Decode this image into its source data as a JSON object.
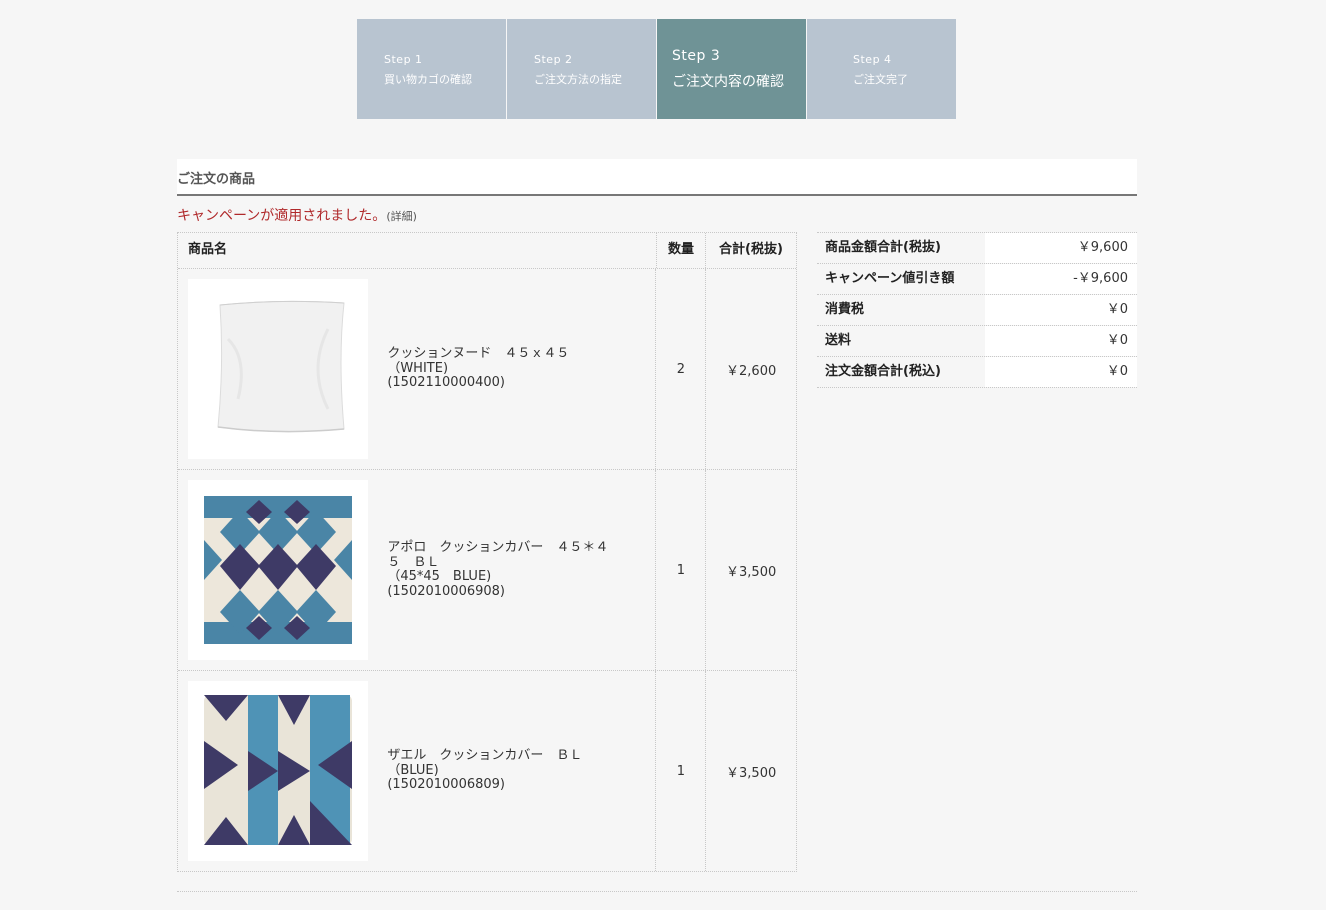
{
  "steps": [
    {
      "num": "Step 1",
      "label": "買い物カゴの確認",
      "active": false
    },
    {
      "num": "Step 2",
      "label": "ご注文方法の指定",
      "active": false
    },
    {
      "num": "Step 3",
      "label": "ご注文内容の確認",
      "active": true
    },
    {
      "num": "Step 4",
      "label": "ご注文完了",
      "active": false
    }
  ],
  "section": {
    "title": "ご注文の商品"
  },
  "campaign": {
    "message": "キャンペーンが適用されました。",
    "detail_link": "(詳細)"
  },
  "items_table": {
    "headers": {
      "name": "商品名",
      "qty": "数量",
      "total": "合計(税抜)"
    },
    "rows": [
      {
        "name": "クッションヌード　４５ｘ４５\n（WHITE)\n(1502110000400)",
        "qty": "2",
        "total": "￥2,600",
        "image": "white-cushion"
      },
      {
        "name": "アポロ　クッションカバー　４５＊４\n５　ＢＬ\n（45*45　BLUE)\n(1502010006908)",
        "qty": "1",
        "total": "￥3,500",
        "image": "apollo-blue-cushion"
      },
      {
        "name": "ザエル　クッションカバー　ＢＬ\n（BLUE)\n(1502010006809)",
        "qty": "1",
        "total": "￥3,500",
        "image": "zael-blue-cushion"
      }
    ]
  },
  "summary": [
    {
      "label": "商品金額合計(税抜)",
      "value": "￥9,600"
    },
    {
      "label": "キャンペーン値引き額",
      "value": "-￥9,600"
    },
    {
      "label": "消費税",
      "value": "￥0"
    },
    {
      "label": "送料",
      "value": "￥0"
    },
    {
      "label": "注文金額合計(税込)",
      "value": "￥0"
    }
  ],
  "colors": {
    "step_inactive": "#b8c4d0",
    "step_active": "#6f9396",
    "campaign_text": "#b0292b"
  }
}
